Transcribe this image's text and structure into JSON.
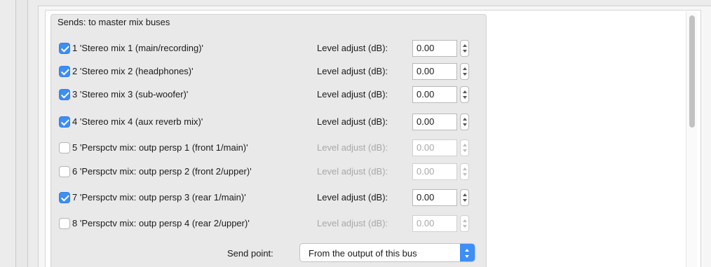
{
  "group": {
    "title": "Sends: to master mix buses"
  },
  "sends": [
    {
      "label": "1 'Stereo mix 1 (main/recording)'",
      "checked": true,
      "level_label": "Level adjust (dB):",
      "value": "0.00"
    },
    {
      "label": "2 'Stereo mix 2 (headphones)'",
      "checked": true,
      "level_label": "Level adjust (dB):",
      "value": "0.00"
    },
    {
      "label": "3 'Stereo mix 3 (sub-woofer)'",
      "checked": true,
      "level_label": "Level adjust (dB):",
      "value": "0.00"
    },
    {
      "label": "4 'Stereo mix 4 (aux reverb mix)'",
      "checked": true,
      "level_label": "Level adjust (dB):",
      "value": "0.00"
    },
    {
      "label": "5 'Perspctv mix: outp persp 1 (front 1/main)'",
      "checked": false,
      "level_label": "Level adjust (dB):",
      "value": "0.00"
    },
    {
      "label": "6 'Perspctv mix: outp persp 2 (front 2/upper)'",
      "checked": false,
      "level_label": "Level adjust (dB):",
      "value": "0.00"
    },
    {
      "label": "7 'Perspctv mix: outp persp 3 (rear 1/main)'",
      "checked": true,
      "level_label": "Level adjust (dB):",
      "value": "0.00"
    },
    {
      "label": "8 'Perspctv mix: outp persp 4 (rear 2/upper)'",
      "checked": false,
      "level_label": "Level adjust (dB):",
      "value": "0.00"
    }
  ],
  "send_point": {
    "label": "Send point:",
    "value": "From the output of this bus"
  },
  "colors": {
    "accent": "#3d8ef7",
    "disabled_text": "#a8a8a8"
  }
}
